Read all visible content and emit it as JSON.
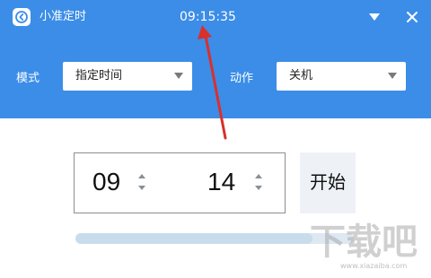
{
  "titlebar": {
    "app_title": "小准定时",
    "clock": "09:15:35",
    "app_icon": "back-arrow-icon",
    "dropdown_icon": "triangle-down-icon",
    "close_icon": "close-icon"
  },
  "settings": {
    "mode_label": "模式",
    "mode_value": "指定时间",
    "action_label": "动作",
    "action_value": "关机"
  },
  "timer": {
    "hour": "09",
    "minute": "14",
    "start_label": "开始",
    "progress": 0.85
  },
  "annotation": {
    "arrow_color": "#d9302c"
  },
  "watermark": {
    "text": "下载吧",
    "subtext": "www.xiazaiba.com"
  },
  "colors": {
    "accent": "#3b8de8",
    "button_bg": "#eef2f7",
    "progress_track": "#dde8f3"
  }
}
